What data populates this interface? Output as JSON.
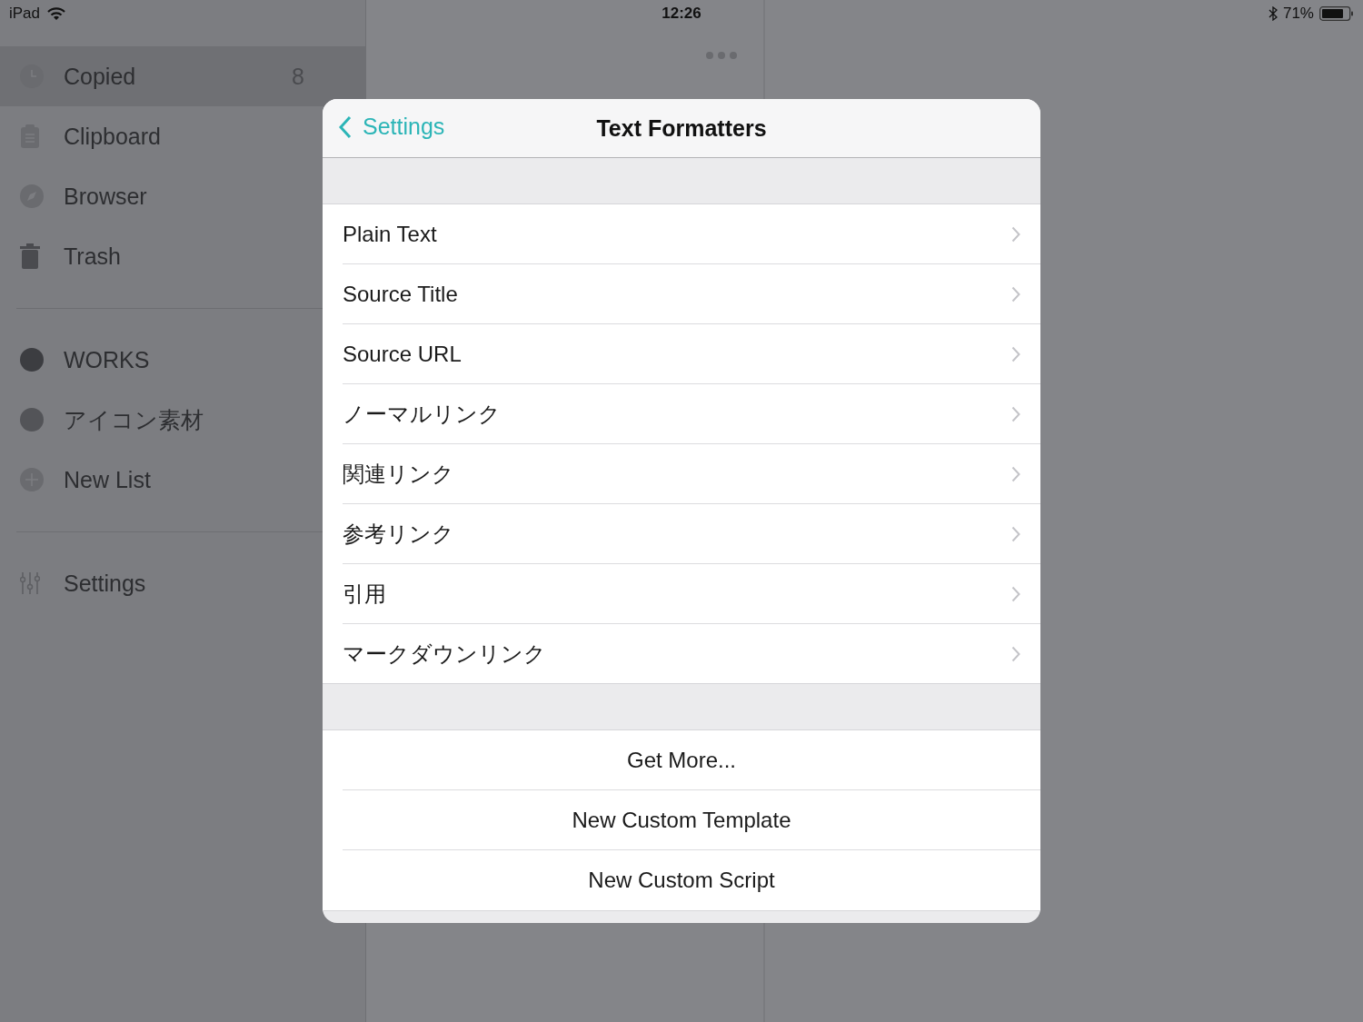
{
  "status_bar": {
    "device": "iPad",
    "time": "12:26",
    "battery": "71%"
  },
  "sidebar": {
    "sections": [
      {
        "items": [
          {
            "label": "Copied",
            "count": "8",
            "selected": true
          },
          {
            "label": "Clipboard",
            "selected": false
          },
          {
            "label": "Browser",
            "selected": false
          },
          {
            "label": "Trash",
            "selected": false
          }
        ]
      },
      {
        "items": [
          {
            "label": "WORKS",
            "kind": "list",
            "color": "#3c3d41",
            "selected": false
          },
          {
            "label": "アイコン素材",
            "kind": "list",
            "color": "#535458",
            "selected": false
          },
          {
            "label": "New List",
            "kind": "add",
            "selected": false
          }
        ]
      },
      {
        "items": [
          {
            "label": "Settings",
            "selected": false
          }
        ]
      }
    ]
  },
  "modal": {
    "back": "Settings",
    "title": "Text Formatters",
    "formatters": [
      "Plain Text",
      "Source Title",
      "Source URL",
      "ノーマルリンク",
      "関連リンク",
      "参考リンク",
      "引用",
      "マークダウンリンク"
    ],
    "actions": [
      "Get More...",
      "New Custom Template",
      "New Custom Script"
    ]
  }
}
